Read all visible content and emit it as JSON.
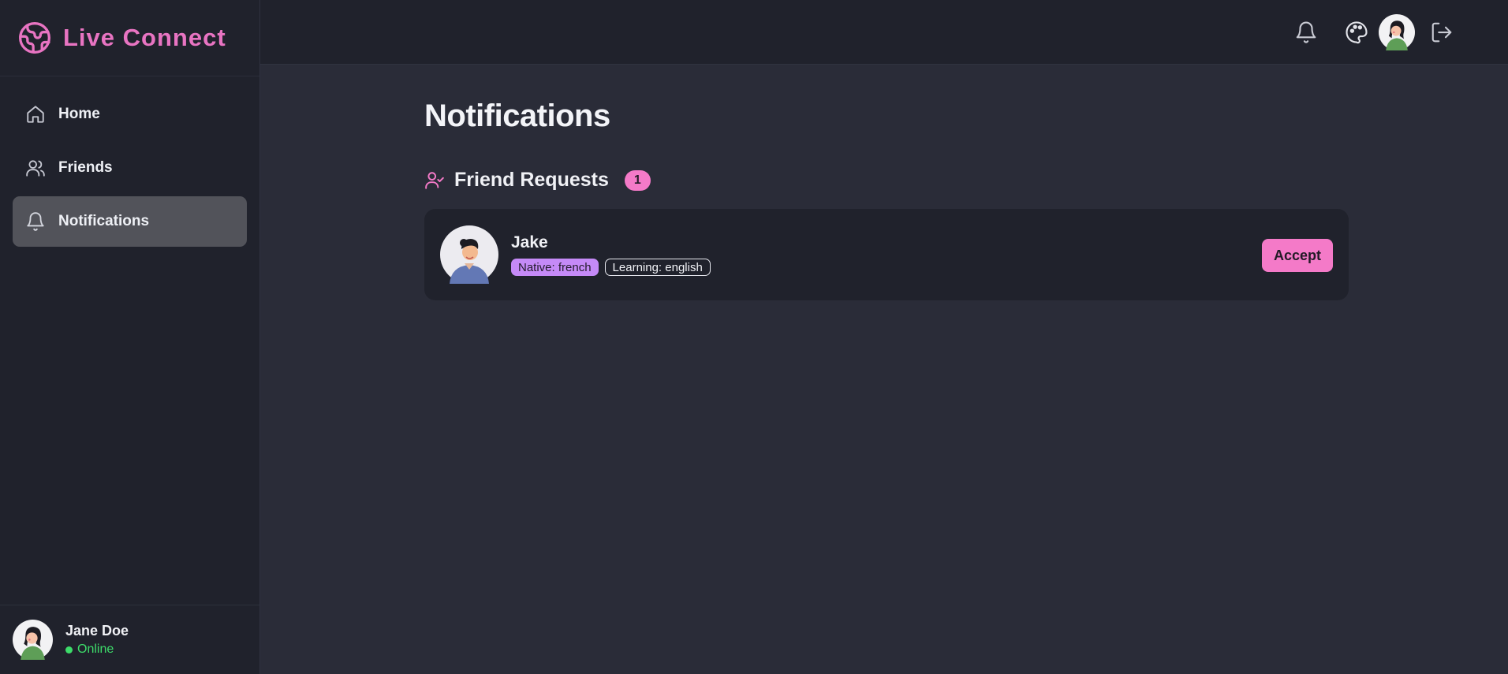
{
  "app": {
    "title": "Live Connect"
  },
  "sidebar": {
    "items": [
      {
        "label": "Home"
      },
      {
        "label": "Friends"
      },
      {
        "label": "Notifications",
        "active": true
      }
    ],
    "user": {
      "name": "Jane Doe",
      "status": "Online"
    }
  },
  "page": {
    "title": "Notifications"
  },
  "friend_requests": {
    "heading": "Friend Requests",
    "count": "1",
    "items": [
      {
        "name": "Jake",
        "native": "Native: french",
        "learning": "Learning: english",
        "accept_label": "Accept"
      }
    ]
  },
  "colors": {
    "accent": "#f47ac8",
    "native_tag": "#c58af7",
    "online": "#3ddc6a",
    "background": "#2a2c38",
    "panel": "#20222c"
  }
}
